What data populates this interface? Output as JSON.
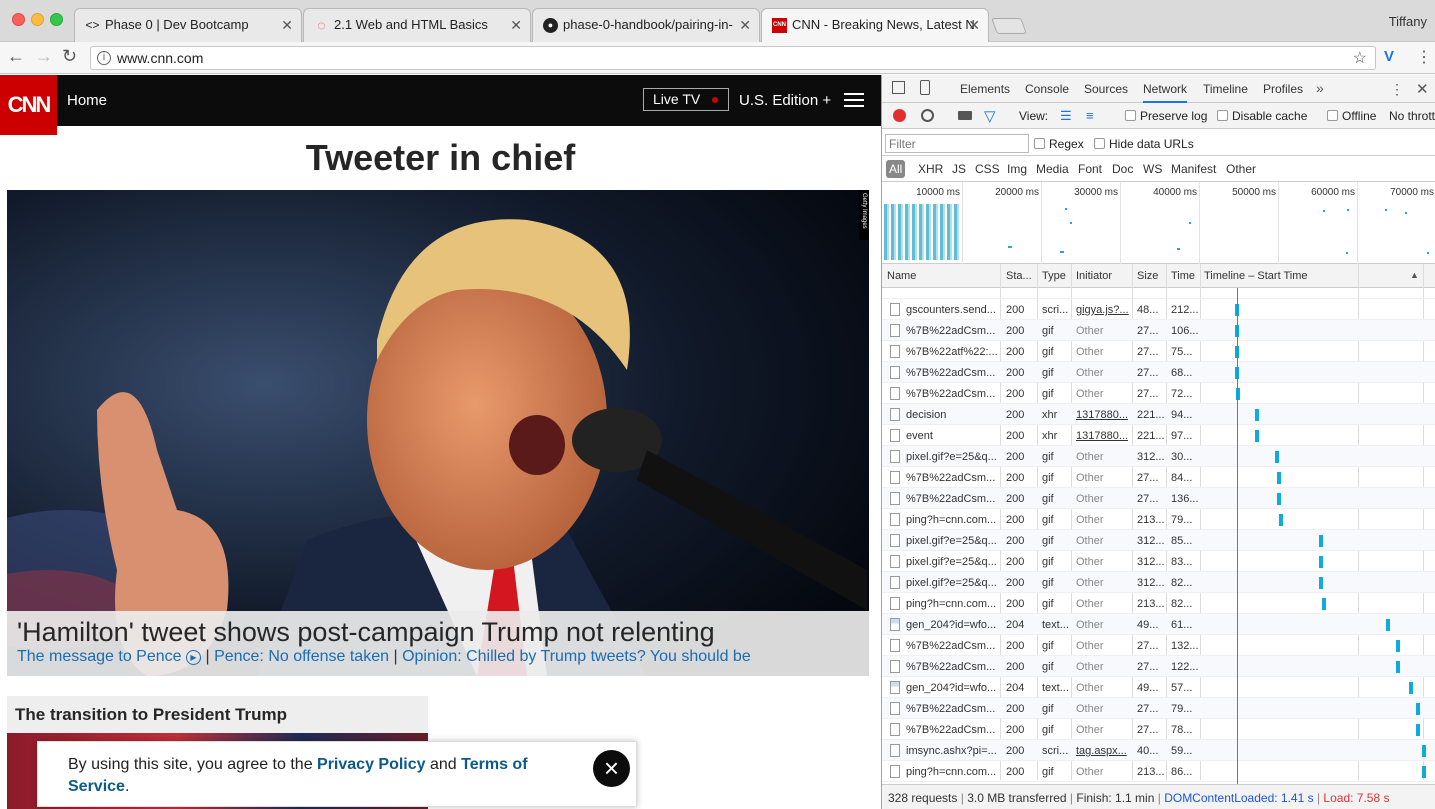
{
  "browser": {
    "user": "Tiffany",
    "tabs": [
      {
        "title": "Phase 0 | Dev Bootcamp",
        "icon": "code-icon"
      },
      {
        "title": "2.1 Web and HTML Basics",
        "icon": "circle-icon"
      },
      {
        "title": "phase-0-handbook/pairing-in-",
        "icon": "github-icon"
      },
      {
        "title": "CNN - Breaking News, Latest N",
        "icon": "cnn-icon"
      }
    ],
    "url": "www.cnn.com"
  },
  "cnn": {
    "logo": "CNN",
    "nav_home": "Home",
    "live_tv": "Live TV",
    "edition": "U.S. Edition +",
    "headline": "Tweeter in chief",
    "photo_credit": "Getty Images",
    "caption_title": "'Hamilton' tweet shows post-campaign Trump not relenting",
    "caption_links": [
      "The message to Pence",
      "Pence: No offense taken",
      "Opinion: Chilled by Trump tweets? You should be"
    ],
    "section_title": "The transition to President Trump",
    "cookie": {
      "prefix": "By using this site, you agree to the ",
      "privacy": "Privacy Policy",
      "and": " and ",
      "terms": "Terms of Service",
      "suffix": "."
    }
  },
  "devtools": {
    "tabs": [
      "Elements",
      "Console",
      "Sources",
      "Network",
      "Timeline",
      "Profiles"
    ],
    "active_tab": "Network",
    "view_label": "View:",
    "preserve_log": "Preserve log",
    "disable_cache": "Disable cache",
    "offline": "Offline",
    "throttle": "No thrott",
    "filter_placeholder": "Filter",
    "regex": "Regex",
    "hide_data_urls": "Hide data URLs",
    "types": [
      "All",
      "XHR",
      "JS",
      "CSS",
      "Img",
      "Media",
      "Font",
      "Doc",
      "WS",
      "Manifest",
      "Other"
    ],
    "overview_ticks": [
      "10000 ms",
      "20000 ms",
      "30000 ms",
      "40000 ms",
      "50000 ms",
      "60000 ms",
      "70000 ms"
    ],
    "columns": [
      "Name",
      "Sta...",
      "Type",
      "Initiator",
      "Size",
      "Time",
      "Timeline – Start Time"
    ],
    "rows": [
      {
        "name": "gscounters.send...",
        "status": "200",
        "type": "scri...",
        "initiator": "gigya.js?...",
        "size": "48...",
        "time": "212...",
        "bar": 0.1,
        "link": true,
        "doc": false
      },
      {
        "name": "%7B%22adCsm...",
        "status": "200",
        "type": "gif",
        "initiator": "Other",
        "size": "27...",
        "time": "106...",
        "bar": 0.1,
        "link": false,
        "doc": false
      },
      {
        "name": "%7B%22atf%22:...",
        "status": "200",
        "type": "gif",
        "initiator": "Other",
        "size": "27...",
        "time": "75...",
        "bar": 0.1,
        "link": false,
        "doc": false
      },
      {
        "name": "%7B%22adCsm...",
        "status": "200",
        "type": "gif",
        "initiator": "Other",
        "size": "27...",
        "time": "68...",
        "bar": 0.1,
        "link": false,
        "doc": false
      },
      {
        "name": "%7B%22adCsm...",
        "status": "200",
        "type": "gif",
        "initiator": "Other",
        "size": "27...",
        "time": "72...",
        "bar": 0.102,
        "link": false,
        "doc": false
      },
      {
        "name": "decision",
        "status": "200",
        "type": "xhr",
        "initiator": "1317880...",
        "size": "221...",
        "time": "94...",
        "bar": 0.16,
        "link": true,
        "doc": false
      },
      {
        "name": "event",
        "status": "200",
        "type": "xhr",
        "initiator": "1317880...",
        "size": "221...",
        "time": "97...",
        "bar": 0.16,
        "link": true,
        "doc": false
      },
      {
        "name": "pixel.gif?e=25&q...",
        "status": "200",
        "type": "gif",
        "initiator": "Other",
        "size": "312...",
        "time": "30...",
        "bar": 0.22,
        "link": false,
        "doc": false
      },
      {
        "name": "%7B%22adCsm...",
        "status": "200",
        "type": "gif",
        "initiator": "Other",
        "size": "27...",
        "time": "84...",
        "bar": 0.225,
        "link": false,
        "doc": false
      },
      {
        "name": "%7B%22adCsm...",
        "status": "200",
        "type": "gif",
        "initiator": "Other",
        "size": "27...",
        "time": "136...",
        "bar": 0.225,
        "link": false,
        "doc": false
      },
      {
        "name": "ping?h=cnn.com...",
        "status": "200",
        "type": "gif",
        "initiator": "Other",
        "size": "213...",
        "time": "79...",
        "bar": 0.23,
        "link": false,
        "doc": false
      },
      {
        "name": "pixel.gif?e=25&q...",
        "status": "200",
        "type": "gif",
        "initiator": "Other",
        "size": "312...",
        "time": "85...",
        "bar": 0.35,
        "link": false,
        "doc": false
      },
      {
        "name": "pixel.gif?e=25&q...",
        "status": "200",
        "type": "gif",
        "initiator": "Other",
        "size": "312...",
        "time": "83...",
        "bar": 0.35,
        "link": false,
        "doc": false
      },
      {
        "name": "pixel.gif?e=25&q...",
        "status": "200",
        "type": "gif",
        "initiator": "Other",
        "size": "312...",
        "time": "82...",
        "bar": 0.35,
        "link": false,
        "doc": false
      },
      {
        "name": "ping?h=cnn.com...",
        "status": "200",
        "type": "gif",
        "initiator": "Other",
        "size": "213...",
        "time": "82...",
        "bar": 0.36,
        "link": false,
        "doc": false
      },
      {
        "name": "gen_204?id=wfo...",
        "status": "204",
        "type": "text...",
        "initiator": "Other",
        "size": "49...",
        "time": "61...",
        "bar": 0.55,
        "link": false,
        "doc": true
      },
      {
        "name": "%7B%22adCsm...",
        "status": "200",
        "type": "gif",
        "initiator": "Other",
        "size": "27...",
        "time": "132...",
        "bar": 0.58,
        "link": false,
        "doc": false
      },
      {
        "name": "%7B%22adCsm...",
        "status": "200",
        "type": "gif",
        "initiator": "Other",
        "size": "27...",
        "time": "122...",
        "bar": 0.58,
        "link": false,
        "doc": false
      },
      {
        "name": "gen_204?id=wfo...",
        "status": "204",
        "type": "text...",
        "initiator": "Other",
        "size": "49...",
        "time": "57...",
        "bar": 0.62,
        "link": false,
        "doc": true
      },
      {
        "name": "%7B%22adCsm...",
        "status": "200",
        "type": "gif",
        "initiator": "Other",
        "size": "27...",
        "time": "79...",
        "bar": 0.64,
        "link": false,
        "doc": false
      },
      {
        "name": "%7B%22adCsm...",
        "status": "200",
        "type": "gif",
        "initiator": "Other",
        "size": "27...",
        "time": "78...",
        "bar": 0.64,
        "link": false,
        "doc": false
      },
      {
        "name": "imsync.ashx?pi=...",
        "status": "200",
        "type": "scri...",
        "initiator": "tag.aspx...",
        "size": "40...",
        "time": "59...",
        "bar": 0.66,
        "link": true,
        "doc": false
      },
      {
        "name": "ping?h=cnn.com...",
        "status": "200",
        "type": "gif",
        "initiator": "Other",
        "size": "213...",
        "time": "86...",
        "bar": 0.66,
        "link": false,
        "doc": false
      }
    ],
    "status": {
      "requests": "328 requests",
      "transferred": "3.0 MB transferred",
      "finish": "Finish: 1.1 min",
      "dom": "DOMContentLoaded: 1.41 s",
      "load": "Load: 7.58 s"
    }
  },
  "colors": {
    "cnn_red": "#cc0000",
    "link_blue": "#0c5a8a",
    "caption_blue": "#1a6cb3",
    "devtools_blue": "#1a73e8",
    "bar_cyan": "#11aadd"
  }
}
